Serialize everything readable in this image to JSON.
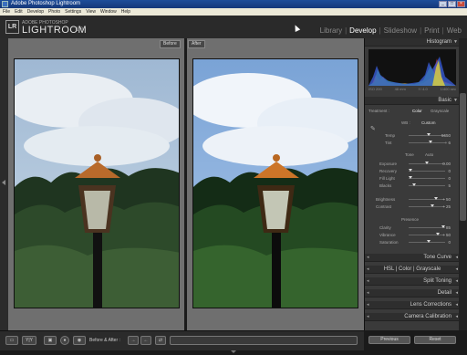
{
  "window": {
    "title": "Adobe Photoshop Lightroom"
  },
  "menu": [
    "File",
    "Edit",
    "Develop",
    "Photo",
    "Settings",
    "View",
    "Window",
    "Help"
  ],
  "identity": {
    "badge": "LR",
    "small": "ADOBE PHOTOSHOP",
    "big": "LIGHTROOM",
    "version": "1.3"
  },
  "modules": [
    "Library",
    "Develop",
    "Slideshow",
    "Print",
    "Web"
  ],
  "active_module": "Develop",
  "compare": {
    "before_label": "Before",
    "after_label": "After"
  },
  "histogram": {
    "title": "Histogram",
    "meta": [
      "ISO 200",
      "48 mm",
      "f / 4.0",
      "1/400 sec"
    ],
    "colors": {
      "red": "#d63a3a",
      "green": "#3bbf3b",
      "blue": "#3a5fe0",
      "yellow": "#e0d23a"
    }
  },
  "basic": {
    "title": "Basic",
    "treatment_label": "Treatment :",
    "treatment_options": [
      "Color",
      "Grayscale"
    ],
    "wb_label": "WB :",
    "wb_value": "Custom",
    "temp_label": "Temp",
    "temp_value": "5650",
    "tint_label": "Tint",
    "tint_value": "+ 6",
    "tone_label": "Tone",
    "auto_label": "Auto",
    "exposure_label": "Exposure",
    "exposure_value": "0.00",
    "recovery_label": "Recovery",
    "recovery_value": "0",
    "fill_label": "Fill Light",
    "fill_value": "0",
    "blacks_label": "Blacks",
    "blacks_value": "5",
    "brightness_label": "Brightness",
    "brightness_value": "+ 50",
    "contrast_label": "Contrast",
    "contrast_value": "+ 25",
    "presence_label": "Presence",
    "clarity_label": "Clarity",
    "clarity_value": "85",
    "vibrance_label": "Vibrance",
    "vibrance_value": "+ 50",
    "saturation_label": "Saturation",
    "saturation_value": "0"
  },
  "panels": {
    "tone_curve": "Tone Curve",
    "hsl_tabs": [
      "HSL",
      "Color",
      "Grayscale"
    ],
    "split_toning": "Split Toning",
    "detail": "Detail",
    "lens_corrections": "Lens Corrections",
    "camera_calibration": "Camera Calibration"
  },
  "footer": {
    "previous": "Previous",
    "reset": "Reset"
  },
  "toolbar": {
    "before_after_label": "Before & After :",
    "view_icon_text": "Y|Y"
  }
}
